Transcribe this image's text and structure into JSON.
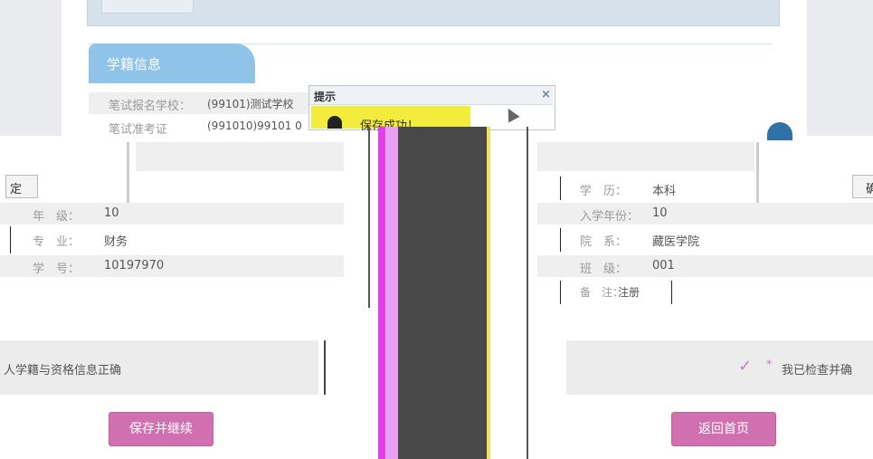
{
  "section": {
    "title": "学籍信息"
  },
  "top_form": [
    {
      "label": "笔试报名学校：",
      "value": "(99101)测试学校"
    },
    {
      "label": "笔试准考证",
      "value": "(991010)99101 0"
    }
  ],
  "dialog": {
    "title": "提示",
    "close": "×",
    "message": "保存成功！",
    "confirm_left": "定",
    "confirm_right": "确"
  },
  "left_rows": [
    {
      "label": "年　级：",
      "value": "10"
    },
    {
      "label": "专　业：",
      "value": "财务"
    },
    {
      "label": "学　号：",
      "value": "10197970"
    }
  ],
  "right_rows": [
    {
      "label": "学　历：",
      "value": "本科"
    },
    {
      "label": "入学年份：",
      "value": "10"
    },
    {
      "label": "院　系：",
      "value": "藏医学院"
    },
    {
      "label": "班　级：",
      "value": "001"
    },
    {
      "label": "备　注：",
      "value": "注册"
    }
  ],
  "note_left": "人学籍与资格信息正确",
  "note_right": "我已检查并确",
  "note_star": "*",
  "check_icon": "✓",
  "buttons": {
    "save_continue": "保存并继续",
    "back_home": "返回首页"
  },
  "colors": {
    "accent_pink": "#d070b0",
    "tab_blue": "#8fc3e8",
    "dialog_highlight": "#f4ec3c",
    "glitch_magenta": "#e040e8"
  }
}
